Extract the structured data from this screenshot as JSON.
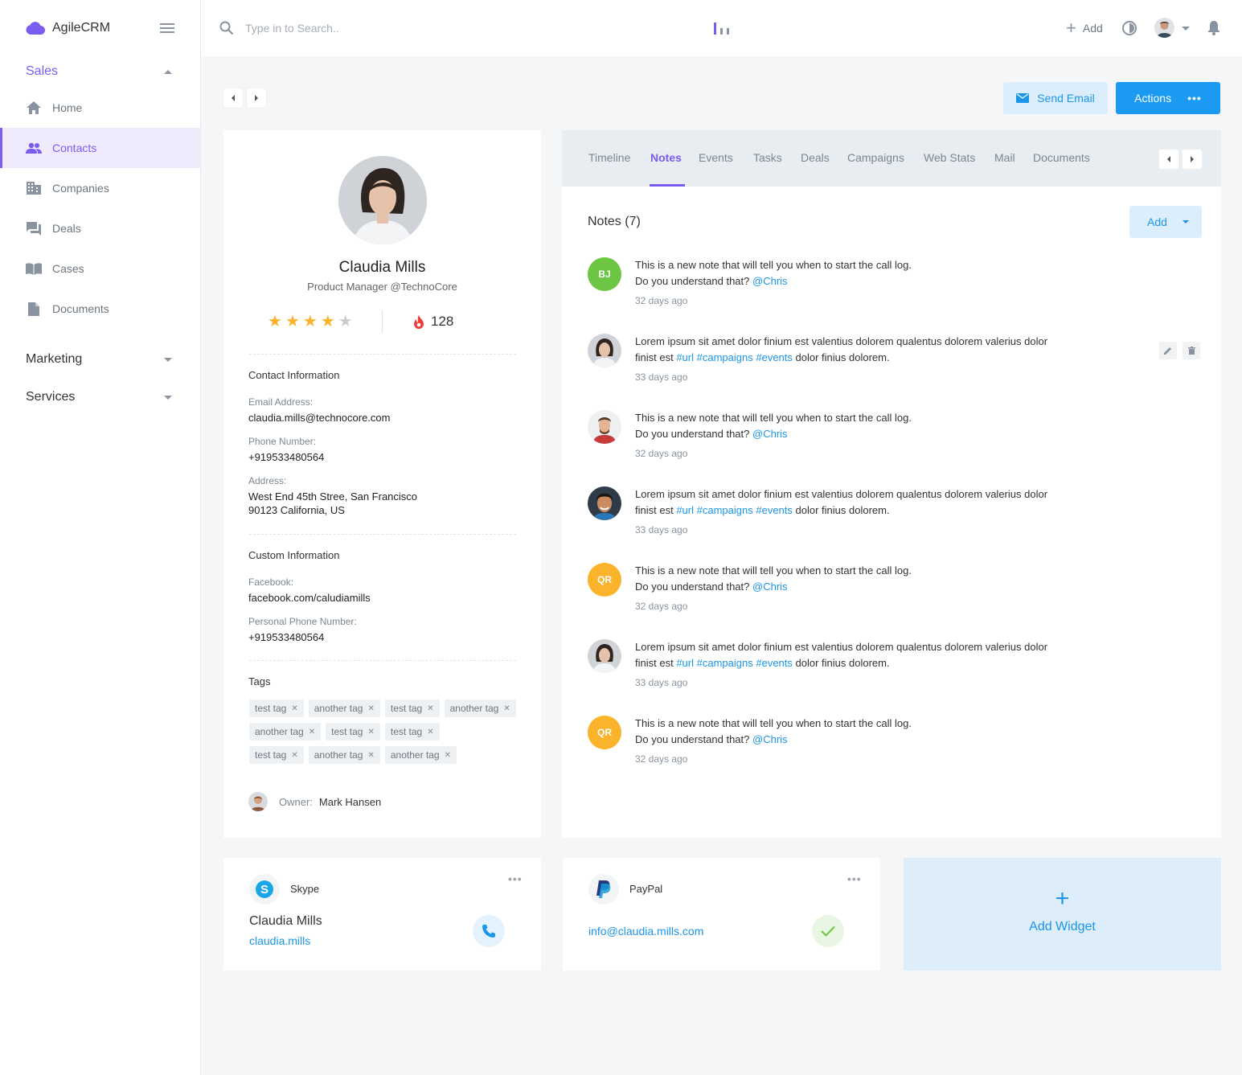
{
  "app": {
    "brand": "AgileCRM"
  },
  "search": {
    "placeholder": "Type in to Search.."
  },
  "topbar": {
    "add_label": "Add"
  },
  "sidebar": {
    "sales": "Sales",
    "items": [
      {
        "label": "Home",
        "icon": "home-icon"
      },
      {
        "label": "Contacts",
        "icon": "contacts-icon"
      },
      {
        "label": "Companies",
        "icon": "companies-icon"
      },
      {
        "label": "Deals",
        "icon": "deals-icon"
      },
      {
        "label": "Cases",
        "icon": "cases-icon"
      },
      {
        "label": "Documents",
        "icon": "documents-icon"
      }
    ],
    "marketing": "Marketing",
    "services": "Services"
  },
  "toolbar": {
    "send_email": "Send Email",
    "actions": "Actions",
    "actions_more": "•••"
  },
  "profile": {
    "name": "Claudia Mills",
    "title": "Product Manager @TechnoCore",
    "rating": 4,
    "rating_max": 5,
    "score": "128",
    "contact_heading": "Contact Information",
    "email_label": "Email Address:",
    "email": "claudia.mills@technocore.com",
    "phone_label": "Phone Number:",
    "phone": "+919533480564",
    "address_label": "Address:",
    "address_line1": "West End 45th Stree, San Francisco",
    "address_line2": "90123 California, US",
    "custom_heading": "Custom Information",
    "facebook_label": "Facebook:",
    "facebook": "facebook.com/caludiamills",
    "personal_phone_label": "Personal Phone Number:",
    "personal_phone": "+919533480564",
    "tags_heading": "Tags",
    "tags": [
      [
        "test tag",
        "another tag",
        "test tag",
        "another tag"
      ],
      [
        "another tag",
        "test tag",
        "test tag"
      ],
      [
        "test tag",
        "another tag",
        "another tag"
      ]
    ],
    "owner_label": "Owner:",
    "owner": "Mark Hansen"
  },
  "tabs": [
    "Timeline",
    "Notes",
    "Events",
    "Tasks",
    "Deals",
    "Campaigns",
    "Web Stats",
    "Mail",
    "Documents"
  ],
  "notes": {
    "title": "Notes (7)",
    "add_label": "Add",
    "items": [
      {
        "avatar": "BJ",
        "color": "#6cc644",
        "line1": "This is a new note that will tell you when to start the call log.",
        "line2": "Do you understand that?",
        "mention": "@Chris",
        "ago": "32 days ago"
      },
      {
        "avatar_img": "woman",
        "line1": "Lorem ipsum sit amet dolor finium est valentius dolorem qualentus dolorem valerius dolor",
        "line2": "finist est",
        "tag1": "#url",
        "tag2": "#campaigns",
        "tag3": "#events",
        "tail": "dolor finius dolorem.",
        "ago": "33 days ago"
      },
      {
        "avatar_img": "man1",
        "line1": "This is a new note that will tell you when to start the call log.",
        "line2": "Do you understand that?",
        "mention": "@Chris",
        "ago": "32 days ago"
      },
      {
        "avatar_img": "man2",
        "line1": "Lorem ipsum sit amet dolor finium est valentius dolorem qualentus dolorem valerius dolor",
        "line2": "finist est",
        "tag1": "#url",
        "tag2": "#campaigns",
        "tag3": "#events",
        "tail": "dolor finius dolorem.",
        "ago": "33 days ago"
      },
      {
        "avatar": "QR",
        "color": "#fbb32c",
        "line1": "This is a new note that will tell you when to start the call log.",
        "line2": "Do you understand that?",
        "mention": "@Chris",
        "ago": "32 days ago"
      },
      {
        "avatar_img": "woman",
        "line1": "Lorem ipsum sit amet dolor finium est valentius dolorem qualentus dolorem valerius dolor",
        "line2": "finist est",
        "tag1": "#url",
        "tag2": "#campaigns",
        "tag3": "#events",
        "tail": "dolor finius dolorem.",
        "ago": "33 days ago"
      },
      {
        "avatar": "QR",
        "color": "#fbb32c",
        "line1": "This is a new note that will tell you when to start the call log.",
        "line2": "Do you understand that?",
        "mention": "@Chris",
        "ago": "32 days ago"
      }
    ]
  },
  "widgets": {
    "skype": {
      "name": "Skype",
      "person": "Claudia Mills",
      "handle": "claudia.mills",
      "more": "•••"
    },
    "paypal": {
      "name": "PayPal",
      "email": "info@claudia.mills.com",
      "more": "•••"
    },
    "add": {
      "plus": "+",
      "label": "Add Widget"
    }
  },
  "colors": {
    "accent": "#7a5cf0",
    "primary": "#1a9af0",
    "star": "#fbb32c"
  }
}
